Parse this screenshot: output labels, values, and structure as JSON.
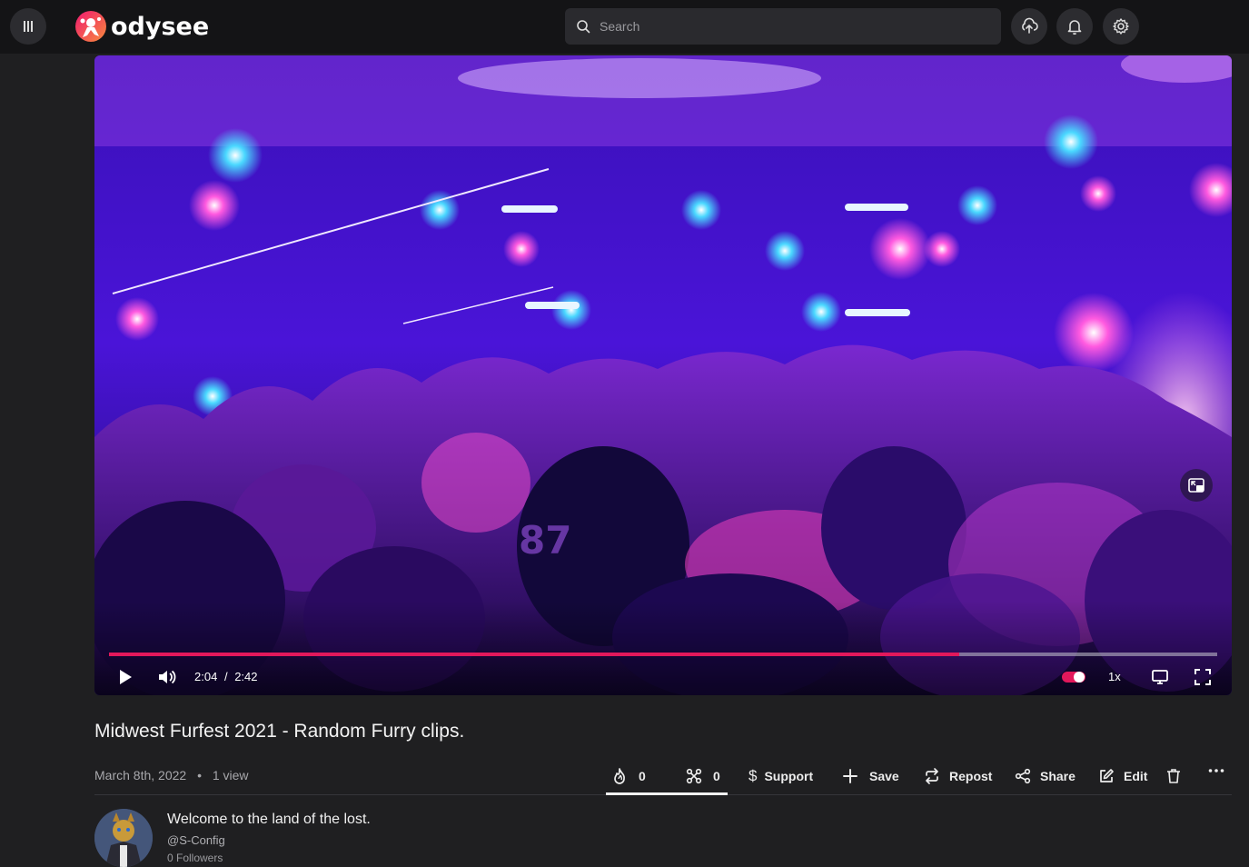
{
  "header": {
    "logo_text": "odysee",
    "search_placeholder": "Search",
    "icons": [
      "menu-icon",
      "upload-icon",
      "bell-icon",
      "gear-icon"
    ]
  },
  "player": {
    "current_time": "2:04",
    "duration": "2:42",
    "time_separator": "/",
    "progress": 0.767,
    "speed": "1x",
    "autoplay_on": true,
    "accent_color": "#e2185b"
  },
  "video": {
    "title": "Midwest Furfest 2021 - Random Furry clips.",
    "date": "March 8th, 2022",
    "views": "1 view"
  },
  "actions": {
    "fire_count": "0",
    "slime_count": "0",
    "support": "Support",
    "save": "Save",
    "repost": "Repost",
    "share": "Share",
    "edit": "Edit"
  },
  "channel": {
    "title": "Welcome to the land of the lost.",
    "handle": "@S-Config",
    "followers": "0 Followers"
  }
}
